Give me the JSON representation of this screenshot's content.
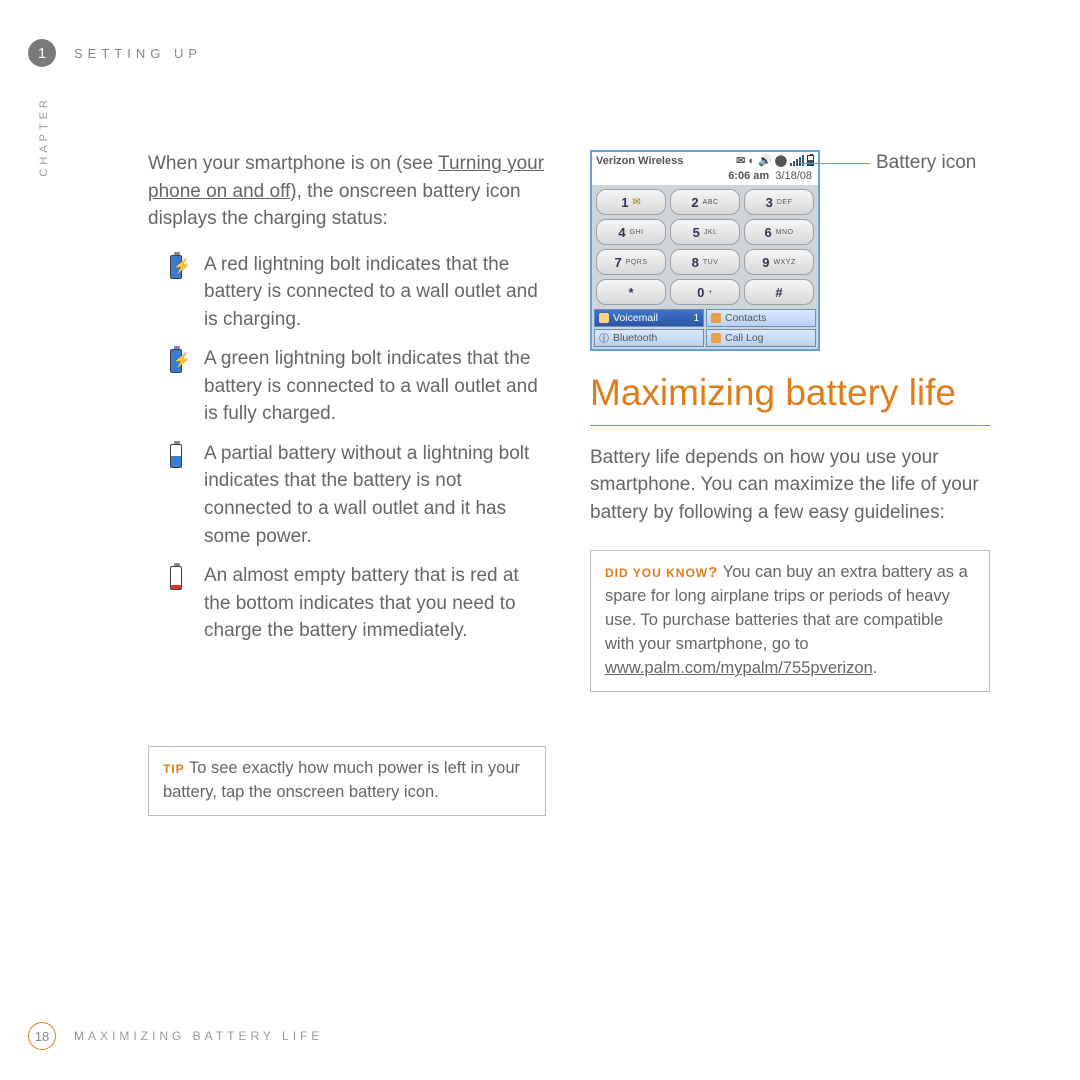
{
  "header": {
    "chapter_num": "1",
    "chapter_name": "SETTING UP",
    "side_label": "CHAPTER"
  },
  "intro": {
    "pre": "When your smartphone is on (see ",
    "link": "Turning your phone on and off",
    "post": "), the onscreen battery icon displays the charging status:"
  },
  "icons": [
    {
      "text": "A red lightning bolt indicates that the battery is connected to a wall outlet and is charging."
    },
    {
      "text": "A green lightning bolt indicates that the battery is connected to a wall outlet and is fully charged."
    },
    {
      "text": "A partial battery without a lightning bolt indicates that the battery is not connected to a wall outlet and it has some power."
    },
    {
      "text": "An almost empty battery that is red at the bottom indicates that you need to charge the battery immediately."
    }
  ],
  "tip": {
    "lead": "TIP",
    "text": "To see exactly how much power is left in your battery, tap the onscreen battery icon."
  },
  "phone": {
    "carrier": "Verizon Wireless",
    "time": "6:06 am",
    "date": "3/18/08",
    "keys": [
      [
        "1",
        ""
      ],
      [
        "2",
        "ABC"
      ],
      [
        "3",
        "DEF"
      ],
      [
        "4",
        "GHI"
      ],
      [
        "5",
        "JKL"
      ],
      [
        "6",
        "MNO"
      ],
      [
        "7",
        "PQRS"
      ],
      [
        "8",
        "TUV"
      ],
      [
        "9",
        "WXYZ"
      ],
      [
        "*",
        ""
      ],
      [
        "0",
        "+"
      ],
      [
        "#",
        ""
      ]
    ],
    "soft": {
      "vm": "Voicemail",
      "vm_n": "1",
      "contacts": "Contacts",
      "bt": "Bluetooth",
      "log": "Call Log"
    },
    "callout": "Battery icon"
  },
  "section_title": "Maximizing battery life",
  "section_body": "Battery life depends on how you use your smartphone. You can maximize the life of your battery by following a few easy guidelines:",
  "dyk": {
    "lead": "DID YOU KNOW",
    "q": "?",
    "text": "You can buy an extra battery as a spare for long airplane trips or periods of heavy use. To purchase batteries that are compatible with your smartphone, go to ",
    "link": "www.palm.com/mypalm/755pverizon",
    "tail": "."
  },
  "footer": {
    "page": "18",
    "title": "MAXIMIZING BATTERY LIFE"
  }
}
